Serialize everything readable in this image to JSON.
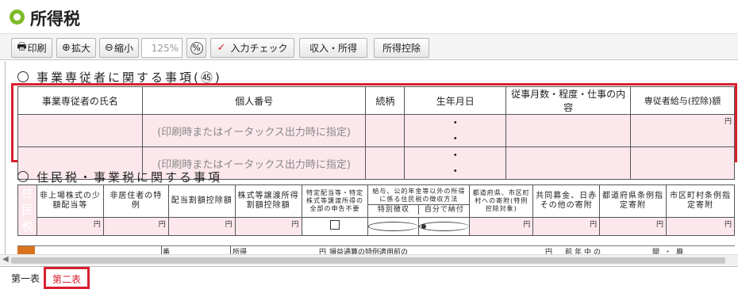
{
  "title": "所得税",
  "toolbar": {
    "print": "印刷",
    "zoom_in": "拡大",
    "zoom_out": "縮小",
    "zoom_value": "125%",
    "input_check": "入力チェック",
    "income": "収入・所得",
    "deduction": "所得控除"
  },
  "section1": {
    "heading": "事業専従者に関する事項(㊺)",
    "columns": [
      "事業専従者の氏名",
      "個人番号",
      "続柄",
      "生年月日",
      "従事月数・程度・仕事の内容",
      "専従者給与(控除)額"
    ],
    "hint": "(印刷時またはイータックス出力時に指定)",
    "dots": "・ ・",
    "yen": "円"
  },
  "section2": {
    "heading": "住民税・事業税に関する事項",
    "label": "住民税",
    "columns": [
      "非上場株式の少額配当等",
      "非居住者の特例",
      "配当割額控除額",
      "株式等譲渡所得割額控除額",
      "特定配当等・特定株式等譲渡所得の全部の申告不要",
      "給与、公的年金等以外の所得に係る住民税の徴収方法",
      "都道府県、市区町村への寄附(特例控除対象)",
      "共同募金、日赤その他の寄附",
      "都道府県条例指定寄附",
      "市区町村条例指定寄附"
    ],
    "collection_options": [
      "特別徴収",
      "自分で納付"
    ],
    "yen": "円"
  },
  "partial": {
    "mark1": "番",
    "text1": "所得",
    "yen": "円",
    "text2": "損益通算の特例適用前の",
    "yen2": "円",
    "text3": "前年中の",
    "text4": "開・廃"
  },
  "tabs": [
    "第一表",
    "第二表"
  ]
}
